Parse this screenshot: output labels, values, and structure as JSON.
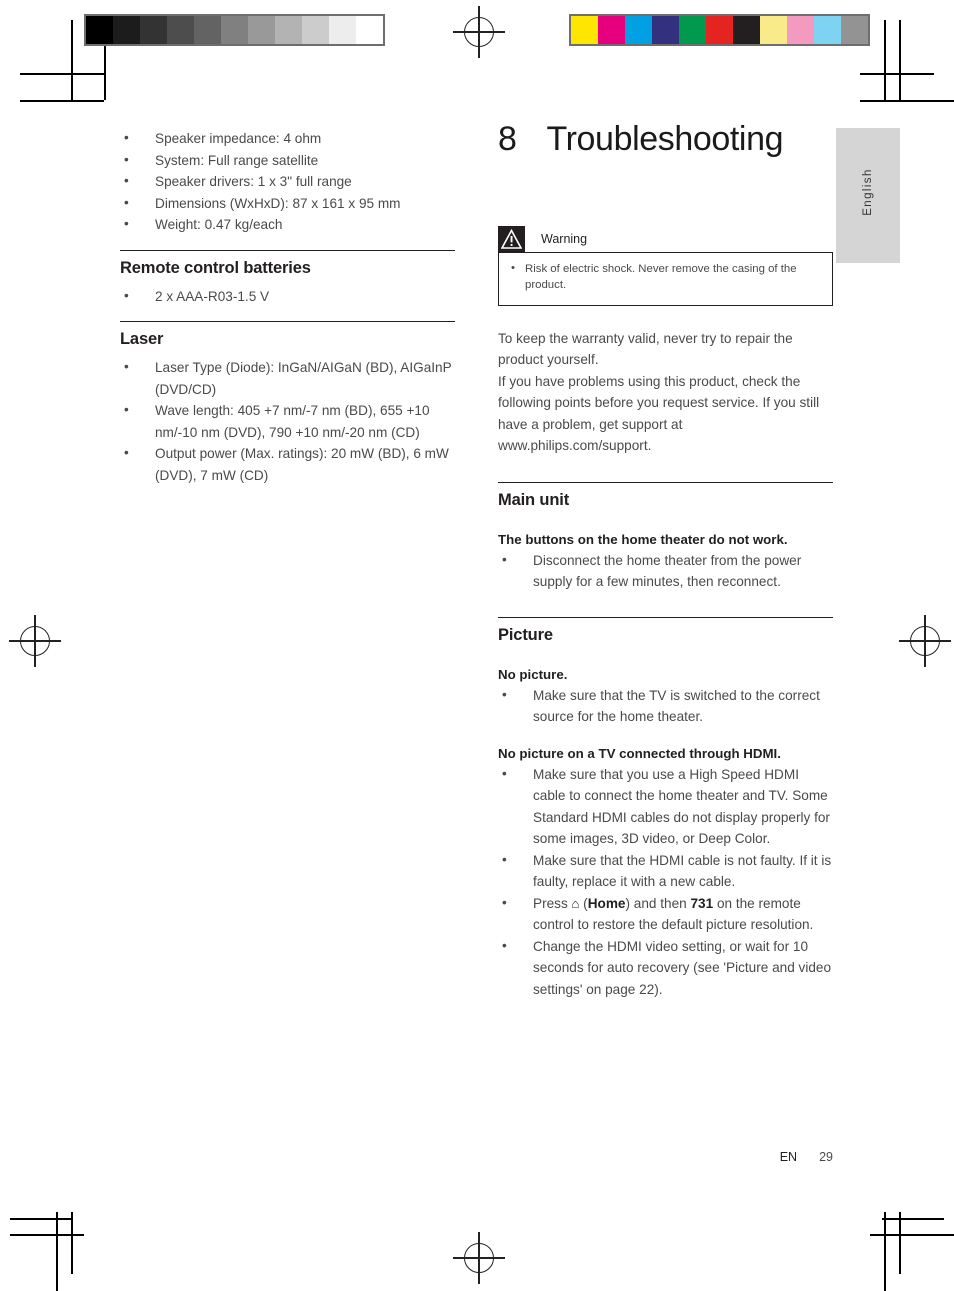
{
  "calibration": {
    "gray_bar_name": "grayscale-calibration-bar",
    "grays": [
      "#000000",
      "#1c1c1c",
      "#333333",
      "#4d4d4d",
      "#636363",
      "#808080",
      "#999999",
      "#b3b3b3",
      "#cccccc",
      "#ededed",
      "#ffffff"
    ],
    "colors": [
      "#ffe600",
      "#e6007e",
      "#00a0e3",
      "#33317f",
      "#00994d",
      "#e52421",
      "#231f20",
      "#faeb8a",
      "#f49ac1",
      "#7ed2f2",
      "#939393"
    ]
  },
  "language_tab": {
    "label": "English"
  },
  "left_column": {
    "spec_bullets": [
      "Speaker impedance: 4 ohm",
      "System: Full range satellite",
      "Speaker drivers: 1 x 3\" full range",
      "Dimensions (WxHxD): 87 x 161 x 95 mm",
      "Weight: 0.47 kg/each"
    ],
    "batteries": {
      "heading": "Remote control batteries",
      "bullets": [
        "2 x AAA-R03-1.5 V"
      ]
    },
    "laser": {
      "heading": "Laser",
      "bullets": [
        "Laser Type (Diode): InGaN/AIGaN (BD), AIGaInP (DVD/CD)",
        "Wave length: 405 +7 nm/-7 nm (BD), 655 +10 nm/-10 nm (DVD), 790 +10 nm/-20 nm (CD)",
        "Output power (Max. ratings): 20 mW (BD), 6 mW (DVD), 7 mW (CD)"
      ]
    }
  },
  "right_column": {
    "chapter_number": "8",
    "chapter_title": "Troubleshooting",
    "warning": {
      "icon": "warning-triangle-icon",
      "label": "Warning",
      "bullets": [
        "Risk of electric shock. Never remove the casing of the product."
      ]
    },
    "intro_paragraphs": [
      "To keep the warranty valid, never try to repair the product yourself.",
      "If you have problems using this product, check the following points before you request service. If you still have a problem, get support at www.philips.com/support."
    ],
    "sections": [
      {
        "heading": "Main unit",
        "symptoms": [
          {
            "title": "The buttons on the home theater do not work.",
            "bullets": [
              "Disconnect the home theater from the power supply for a few minutes, then reconnect."
            ]
          }
        ]
      },
      {
        "heading": "Picture",
        "symptoms": [
          {
            "title": "No picture.",
            "bullets": [
              "Make sure that the TV is switched to the correct source for the home theater."
            ]
          },
          {
            "title": "No picture on a TV connected through HDMI.",
            "bullets": [
              "Make sure that you use a High Speed HDMI cable to connect the home theater and TV. Some Standard HDMI cables do not display properly for some images, 3D video, or Deep Color.",
              "Make sure that the HDMI cable is not faulty. If it is faulty, replace it with a new cable.",
              "Change the HDMI video setting, or wait for 10 seconds for auto recovery (see 'Picture and video settings' on page 22)."
            ],
            "press_bullet": {
              "pre": "Press ",
              "home_icon": "home-icon",
              "mid": " (",
              "home_word": "Home",
              "mid2": ") and then ",
              "code": "731",
              "post": " on the remote control to restore the default picture resolution."
            }
          }
        ]
      }
    ]
  },
  "footer": {
    "language_code": "EN",
    "page_number": "29"
  }
}
